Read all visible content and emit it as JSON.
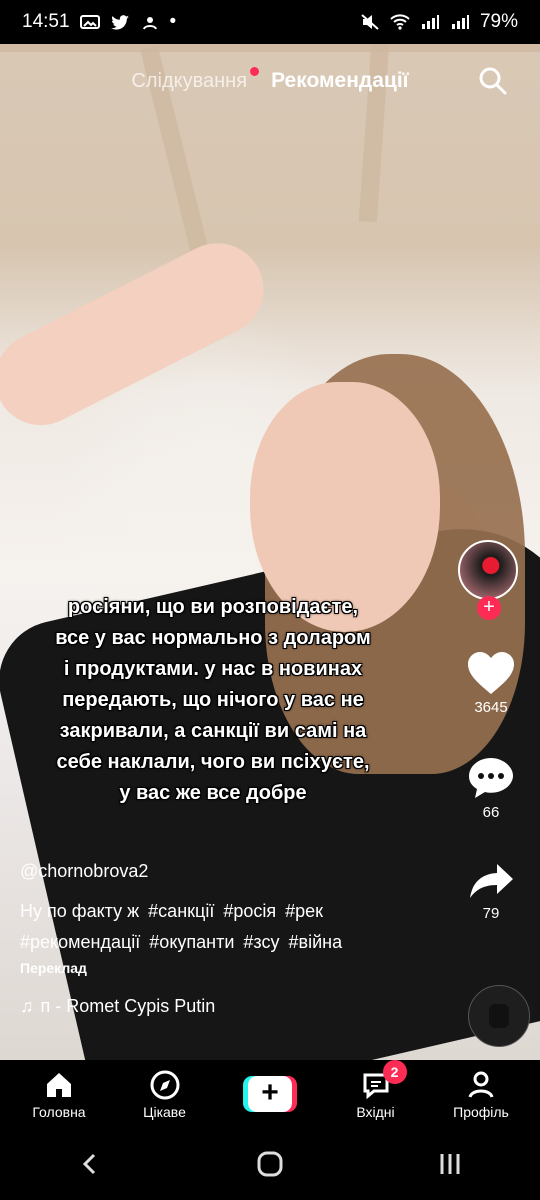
{
  "status_bar": {
    "time": "14:51",
    "dot": "•",
    "battery": "79%",
    "left_icons": [
      "gallery-icon",
      "twitter-icon",
      "app-icon"
    ],
    "right_icons": [
      "mute-icon",
      "wifi-icon",
      "signal-icon",
      "signal-icon"
    ]
  },
  "top_nav": {
    "following_label": "Слідкування",
    "recommended_label": "Рекомендації",
    "search_icon": "search-icon"
  },
  "video": {
    "caption": "росіяни, що ви розповідаєте, все у вас нормально з доларом і продуктами. у нас в новинах передають, що нічого у вас не закривали, а санкції ви самі на себе наклали, чого ви псіхуєте, у вас же все добре"
  },
  "right_rail": {
    "likes": "3645",
    "comments": "66",
    "shares": "79",
    "follow_symbol": "+"
  },
  "post": {
    "username": "@chornobrova2",
    "description_text": "Ну по факту ж",
    "hashtags": [
      "#санкції",
      "#росія",
      "#рек",
      "#рекомендації",
      "#окупанти",
      "#зсу",
      "#війна"
    ],
    "translation_label": "Переклад",
    "music_note": "♫",
    "music_title": "п - Romet     Cypis Putin"
  },
  "bottom_nav": {
    "home": "Головна",
    "discover": "Цікаве",
    "create_symbol": "+",
    "inbox": "Вхідні",
    "profile": "Профіль",
    "inbox_badge": "2"
  },
  "system_nav": {
    "back_icon": "back-icon",
    "home_icon": "home-circle-icon",
    "recent_icon": "recent-apps-icon"
  },
  "colors": {
    "accent": "#fe2c55",
    "cyan": "#25f4ee",
    "white": "#ffffff",
    "black": "#000000"
  }
}
